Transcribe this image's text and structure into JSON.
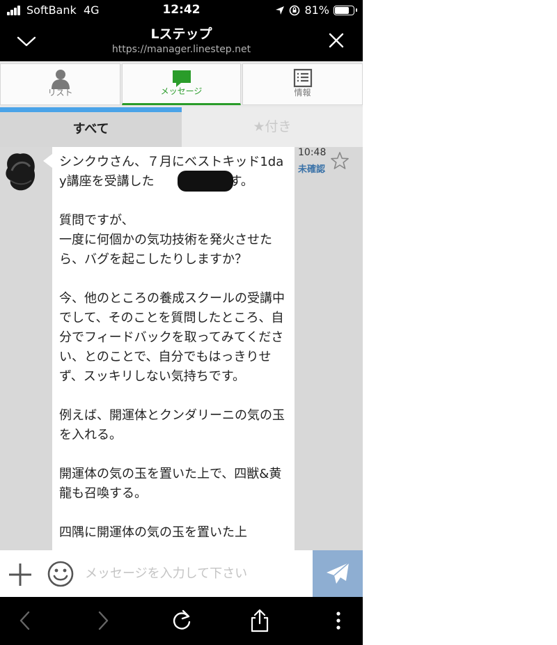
{
  "status_bar": {
    "carrier": "SoftBank",
    "network": "4G",
    "time": "12:42",
    "battery_text": "81%",
    "battery_level": 0.81
  },
  "header": {
    "title": "Lステップ",
    "url": "https://manager.linestep.net"
  },
  "tabs": [
    {
      "label": "リスト",
      "icon": "person-icon",
      "active": false
    },
    {
      "label": "メッセージ",
      "icon": "chat-bubble-icon",
      "active": true
    },
    {
      "label": "情報",
      "icon": "document-list-icon",
      "active": false
    }
  ],
  "subtabs": {
    "all": "すべて",
    "starred": "★付き"
  },
  "message": {
    "text": "シンクウさん、７月にベストキッド1day講座を受講した　　　　　です。\n\n質問ですが、\n一度に何個かの気功技術を発火させたら、バグを起こしたりしますか？\n\n今、他のところの養成スクールの受講中でして、そのことを質問したところ、自分でフィードバックを取ってみてください、とのことで、自分でもはっきりせず、スッキリしない気持ちです。\n\n例えば、開運体とクンダリーニの気の玉を入れる。\n\n開運体の気の玉を置いた上で、四獣&黄龍も召喚する。\n\n四隅に開運体の気の玉を置いた上",
    "time": "10:48",
    "status": "未確認"
  },
  "input": {
    "placeholder": "メッセージを入力して下さい"
  },
  "colors": {
    "accent_green": "#2a9c2a",
    "progress_blue": "#4aa3e8",
    "send_button": "#8eaed2",
    "unread_blue": "#3a72a8"
  }
}
